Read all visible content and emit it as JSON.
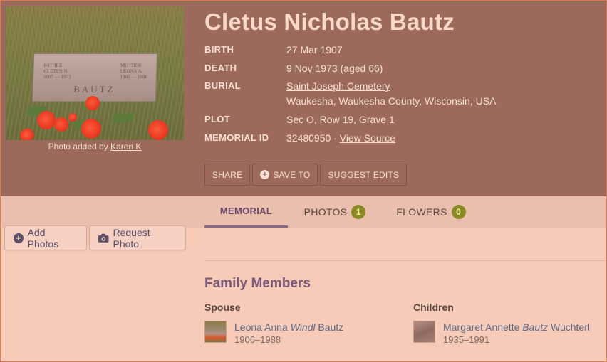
{
  "memorial": {
    "name": "Cletus Nicholas Bautz",
    "photo_caption_prefix": "Photo added by",
    "photo_added_by": "Karen K",
    "headstone": {
      "surname": "BAUTZ",
      "left_lines": [
        "FATHER",
        "CLETUS N.",
        "1907 — 1973"
      ],
      "right_lines": [
        "MOTHER",
        "LEONA A.",
        "1906 — 1988"
      ]
    },
    "facts": [
      {
        "label": "BIRTH",
        "value": "27 Mar 1907"
      },
      {
        "label": "DEATH",
        "value": "9 Nov 1973 (aged 66)"
      },
      {
        "label": "BURIAL",
        "link": "Saint Joseph Cemetery",
        "value2": "Waukesha, Waukesha County, Wisconsin, USA"
      },
      {
        "label": "PLOT",
        "value": "Sec O, Row 19, Grave 1"
      },
      {
        "label": "MEMORIAL ID",
        "value": "32480950 ·",
        "link": "View Source"
      }
    ],
    "actions": {
      "share": "SHARE",
      "save_to": "SAVE TO",
      "suggest_edits": "SUGGEST EDITS"
    }
  },
  "tabs": [
    {
      "label": "MEMORIAL",
      "active": true
    },
    {
      "label": "PHOTOS",
      "count": "1"
    },
    {
      "label": "FLOWERS",
      "count": "0"
    }
  ],
  "sidebar": {
    "add_photos": "Add Photos",
    "request_photo": "Request Photo"
  },
  "family": {
    "title": "Family Members",
    "spouse": {
      "heading": "Spouse",
      "first": "Leona Anna",
      "maiden": "Windl",
      "last": "Bautz",
      "dates": "1906–1988"
    },
    "children": {
      "heading": "Children",
      "first": "Margaret Annette",
      "maiden": "Bautz",
      "last": "Wuchterl",
      "dates": "1935–1991"
    }
  },
  "colors": {
    "header_bg": "#9b6a5a",
    "page_bg": "#f8cbb9",
    "tabs_bg": "#ebbfad",
    "badge": "#8a8a24",
    "accent": "#8a6a8a"
  }
}
